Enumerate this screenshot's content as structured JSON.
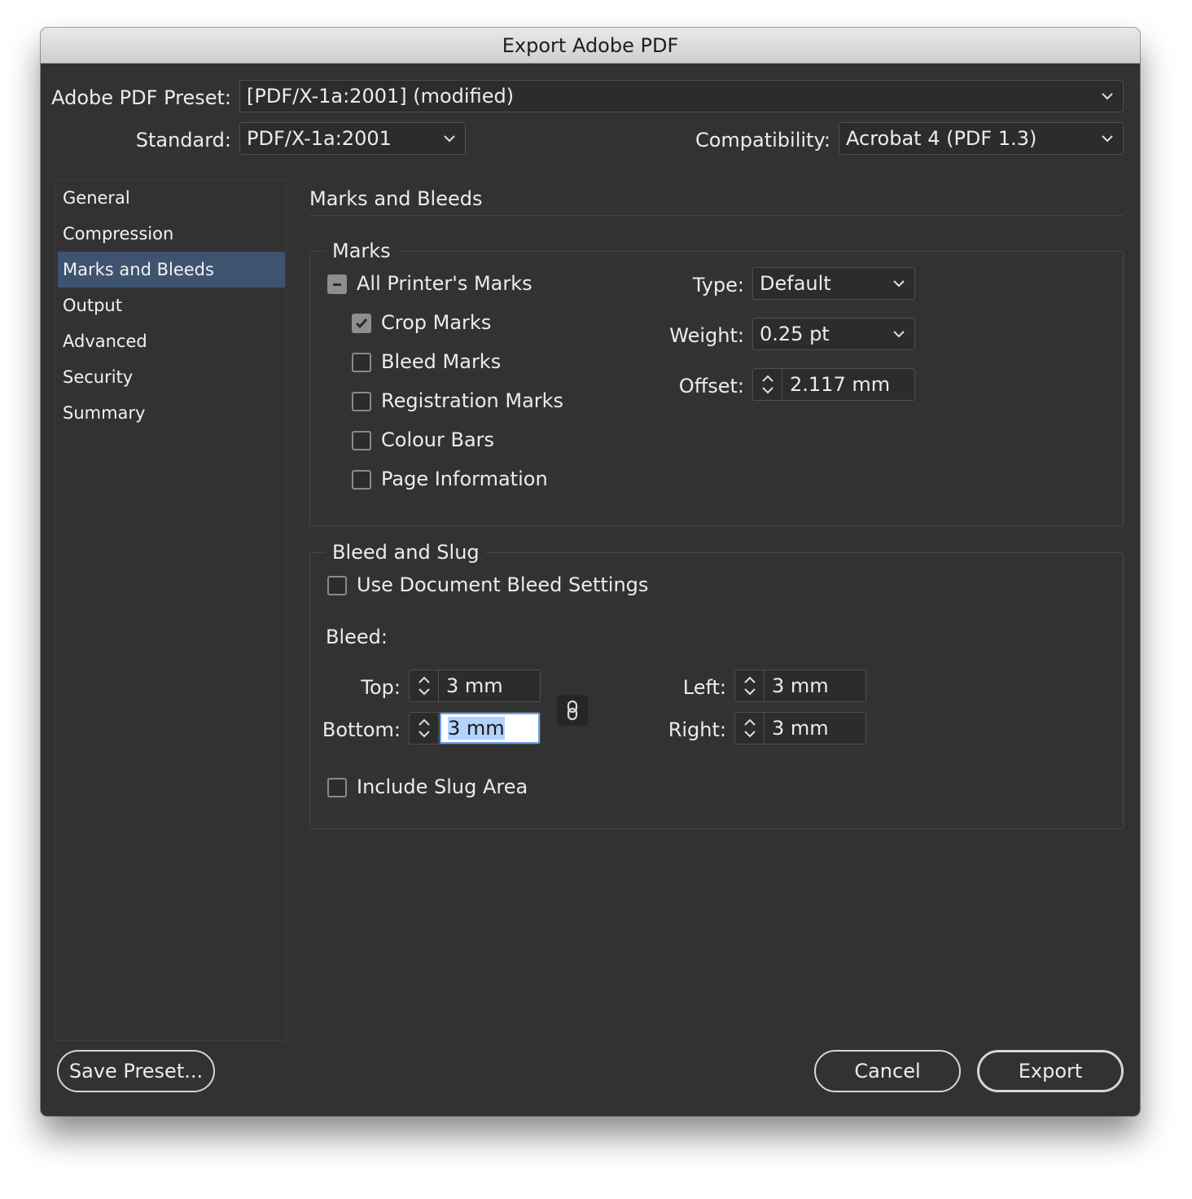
{
  "window": {
    "title": "Export Adobe PDF"
  },
  "preset": {
    "label": "Adobe PDF Preset:",
    "value": "[PDF/X-1a:2001] (modified)"
  },
  "standard": {
    "label": "Standard:",
    "value": "PDF/X-1a:2001"
  },
  "compatibility": {
    "label": "Compatibility:",
    "value": "Acrobat 4 (PDF 1.3)"
  },
  "sidebar": {
    "items": [
      {
        "label": "General"
      },
      {
        "label": "Compression"
      },
      {
        "label": "Marks and Bleeds"
      },
      {
        "label": "Output"
      },
      {
        "label": "Advanced"
      },
      {
        "label": "Security"
      },
      {
        "label": "Summary"
      }
    ],
    "selected": "Marks and Bleeds"
  },
  "panel": {
    "title": "Marks and Bleeds",
    "marks": {
      "title": "Marks",
      "all_printers_marks": {
        "label": "All Printer's Marks",
        "state": "mixed"
      },
      "crop_marks": {
        "label": "Crop Marks",
        "checked": true
      },
      "bleed_marks": {
        "label": "Bleed Marks",
        "checked": false
      },
      "registration_marks": {
        "label": "Registration Marks",
        "checked": false
      },
      "colour_bars": {
        "label": "Colour Bars",
        "checked": false
      },
      "page_information": {
        "label": "Page Information",
        "checked": false
      },
      "type": {
        "label": "Type:",
        "value": "Default"
      },
      "weight": {
        "label": "Weight:",
        "value": "0.25 pt"
      },
      "offset": {
        "label": "Offset:",
        "value": "2.117 mm"
      }
    },
    "bleed_slug": {
      "title": "Bleed and Slug",
      "use_document_bleed": {
        "label": "Use Document Bleed Settings",
        "checked": false
      },
      "bleed_label": "Bleed:",
      "top": {
        "label": "Top:",
        "value": "3 mm"
      },
      "bottom": {
        "label": "Bottom:",
        "value": "3 mm"
      },
      "left": {
        "label": "Left:",
        "value": "3 mm"
      },
      "right": {
        "label": "Right:",
        "value": "3 mm"
      },
      "include_slug": {
        "label": "Include Slug Area",
        "checked": false
      }
    }
  },
  "buttons": {
    "save_preset": "Save Preset...",
    "cancel": "Cancel",
    "export": "Export"
  },
  "colors": {
    "dialog_bg": "#323232",
    "selection": "#3e5370",
    "focus_ring": "#6ba0ee"
  },
  "icons": {
    "dropdown": "chevron-down-icon",
    "stepper": "stepper-arrows-icon",
    "link": "chain-link-icon",
    "check": "checkmark-icon",
    "mixed": "minus-icon"
  }
}
